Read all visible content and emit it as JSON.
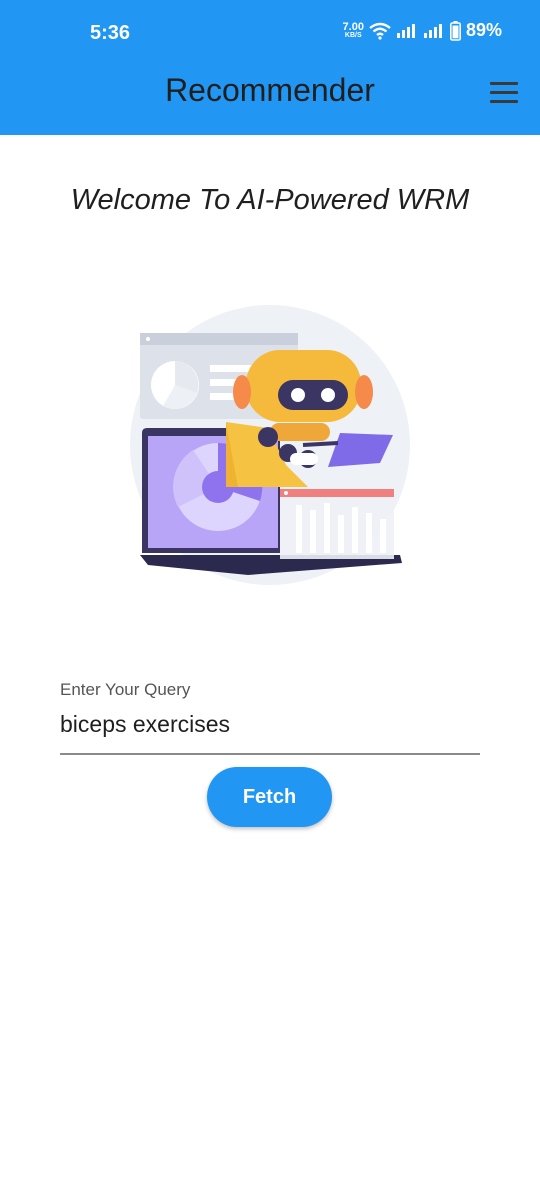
{
  "status_bar": {
    "time": "5:36",
    "net_speed_value": "7.00",
    "net_speed_unit": "KB/S",
    "battery_percent": "89%",
    "icons": [
      "wifi-icon",
      "signal-icon",
      "signal-icon",
      "battery-icon"
    ]
  },
  "app_bar": {
    "title": "Recommender",
    "menu_icon": "hamburger-menu-icon"
  },
  "main": {
    "welcome": "Welcome To AI-Powered WRM",
    "illustration": "robot-with-laptop-illustration",
    "query": {
      "label": "Enter Your Query",
      "value": "biceps exercises"
    },
    "fetch_label": "Fetch"
  },
  "colors": {
    "primary": "#2196f3",
    "background": "#ffffff",
    "text": "#1f1f1f"
  }
}
